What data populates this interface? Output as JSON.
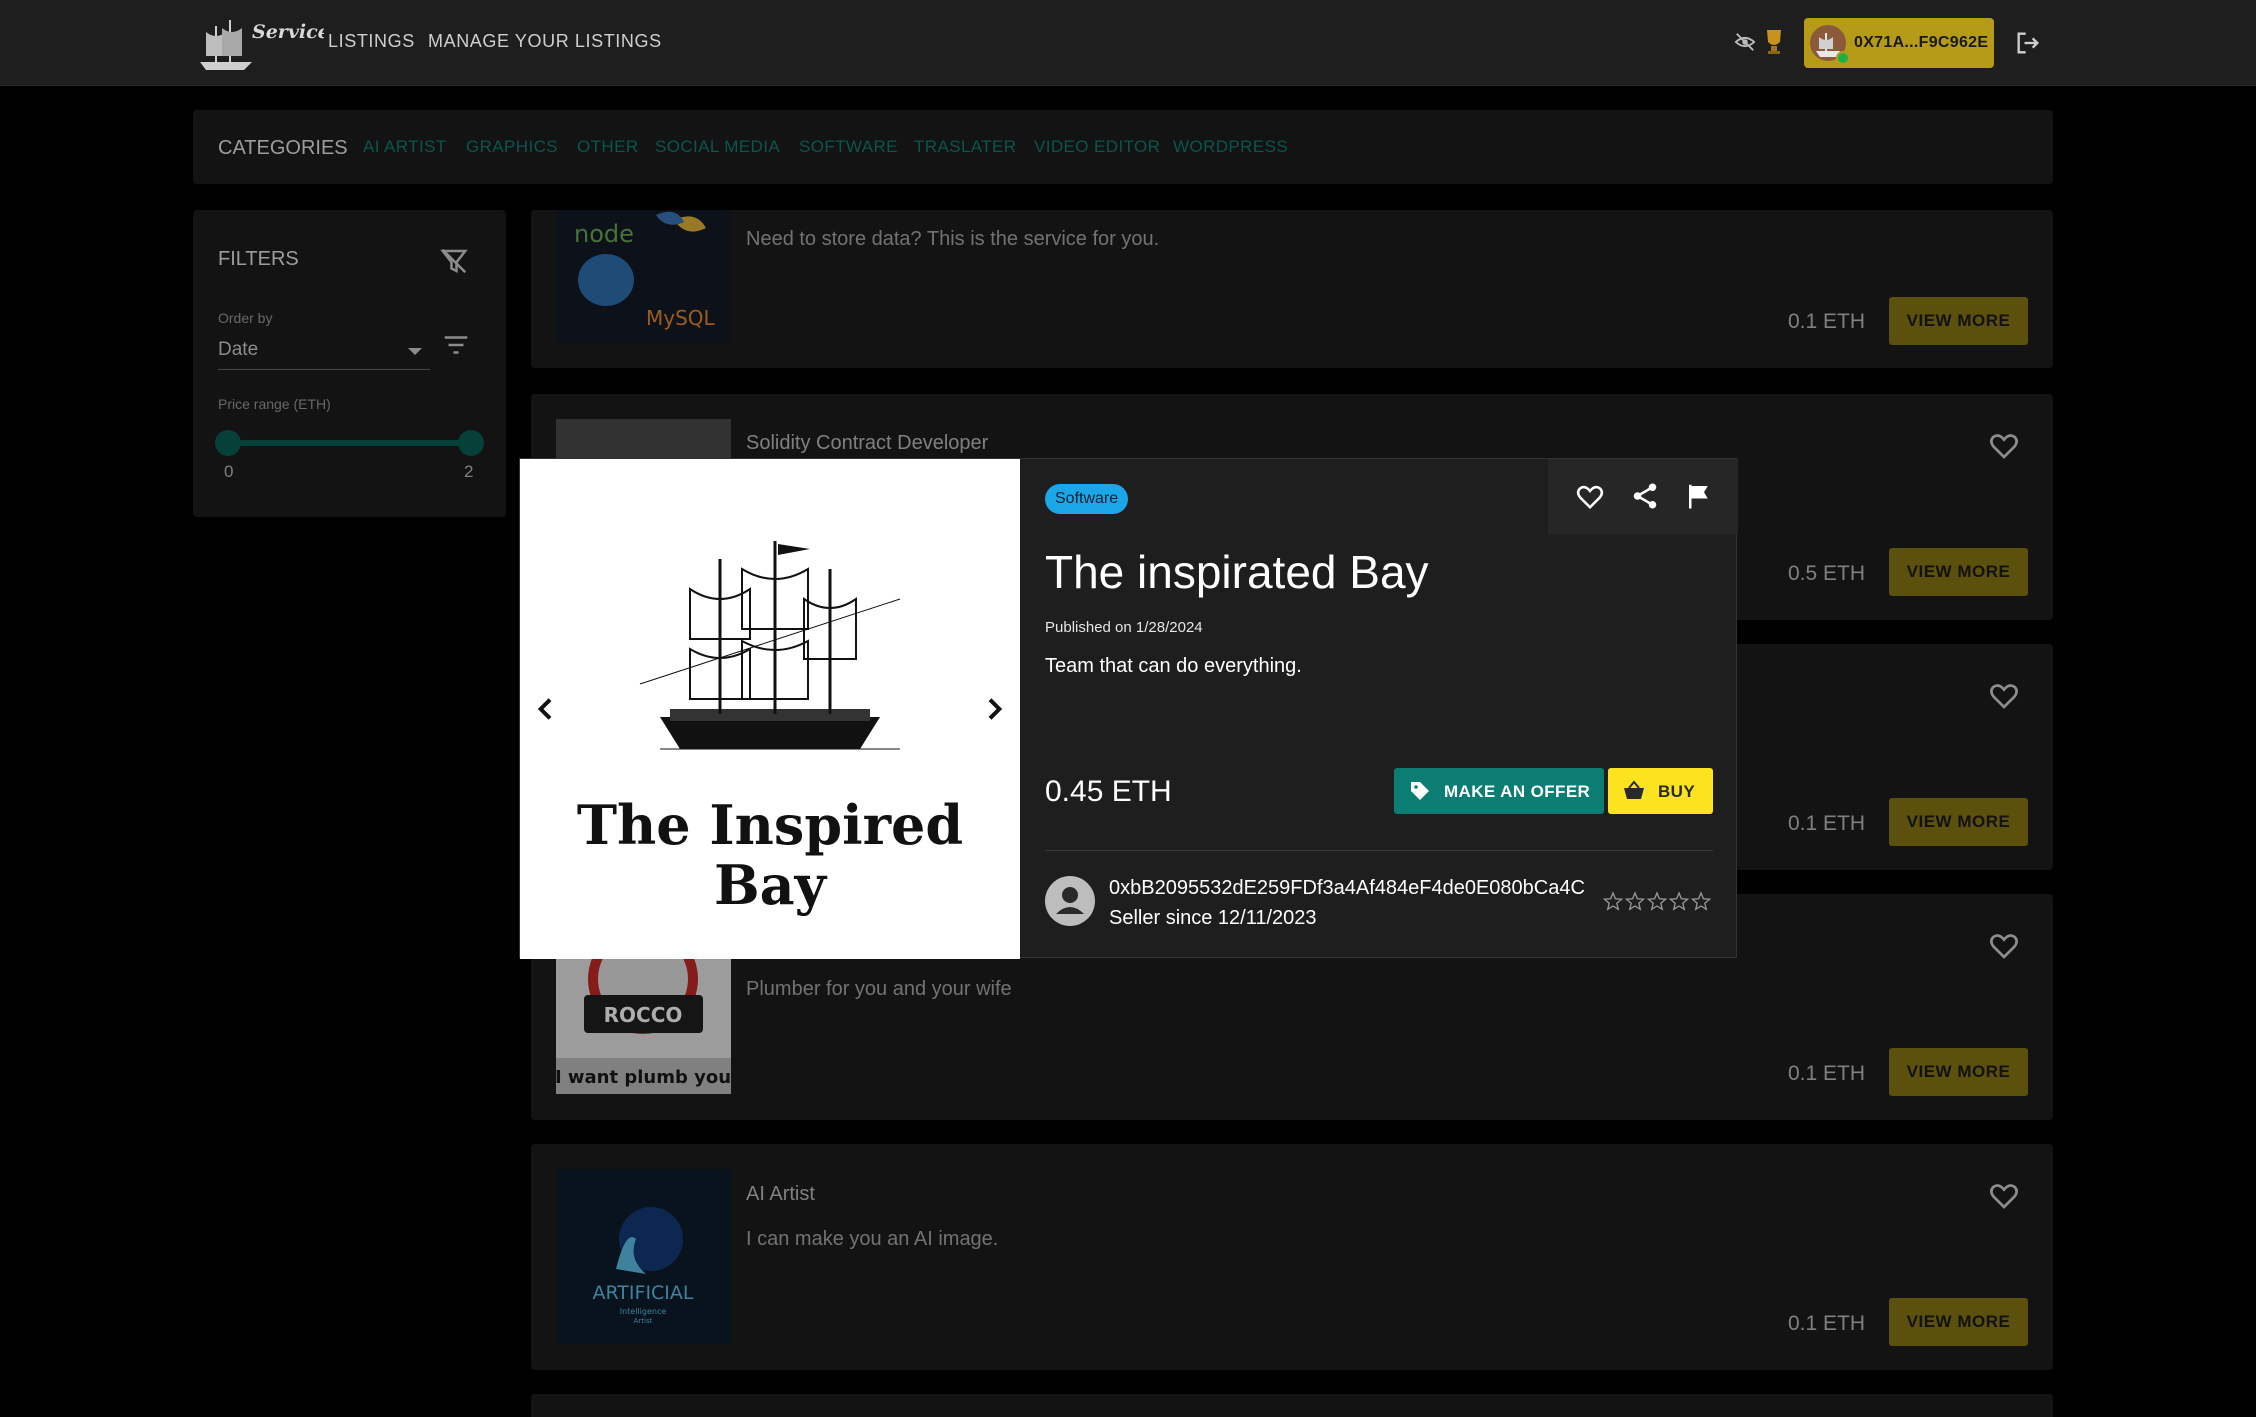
{
  "header": {
    "logo_text": "Service Bay",
    "nav": [
      "LISTINGS",
      "MANAGE YOUR LISTINGS"
    ],
    "account_address": "0X71A...F9C962E"
  },
  "categories": {
    "title": "CATEGORIES",
    "items": [
      "AI ARTIST",
      "GRAPHICS",
      "OTHER",
      "SOCIAL MEDIA",
      "SOFTWARE",
      "TRASLATER",
      "VIDEO EDITOR",
      "WORDPRESS"
    ]
  },
  "filters": {
    "title": "FILTERS",
    "order_by_label": "Order by",
    "order_by_value": "Date",
    "price_label": "Price range (ETH)",
    "price_min": "0",
    "price_max": "2"
  },
  "listings": [
    {
      "title": "",
      "description": "Need to store data? This is the service for you.",
      "price": "0.1 ETH",
      "button": "VIEW MORE"
    },
    {
      "title": "Solidity Contract Developer",
      "description": "",
      "price": "0.5 ETH",
      "button": "VIEW MORE"
    },
    {
      "title": "",
      "description": "",
      "price": "0.1 ETH",
      "button": "VIEW MORE"
    },
    {
      "title": "",
      "description": "Plumber for you and your wife",
      "price": "0.1 ETH",
      "button": "VIEW MORE",
      "thumb_text_1": "ROCCO",
      "thumb_text_2": "I want plumb you"
    },
    {
      "title": "AI Artist",
      "description": "I can make you an AI image.",
      "price": "0.1 ETH",
      "button": "VIEW MORE",
      "thumb_text_1": "ARTIFICIAL",
      "thumb_text_2": "Intelligence",
      "thumb_text_3": "Artist"
    }
  ],
  "modal": {
    "category_chip": "Software",
    "title": "The inspirated Bay",
    "published": "Published on 1/28/2024",
    "description": "Team that can do everything.",
    "price": "0.45 ETH",
    "offer_label": "MAKE AN OFFER",
    "buy_label": "BUY",
    "image_caption_1": "The Inspired",
    "image_caption_2": "Bay",
    "seller_address": "0xbB2095532dE259FDf3a4Af484eF4de0E080bCa4C",
    "seller_since": "Seller since 12/11/2023",
    "rating": 0,
    "rating_max": 5
  },
  "colors": {
    "accent_teal": "#0b7d73",
    "accent_gold": "#877612",
    "buy_yellow": "#fbe31f",
    "chip_blue": "#1ba6e8"
  }
}
